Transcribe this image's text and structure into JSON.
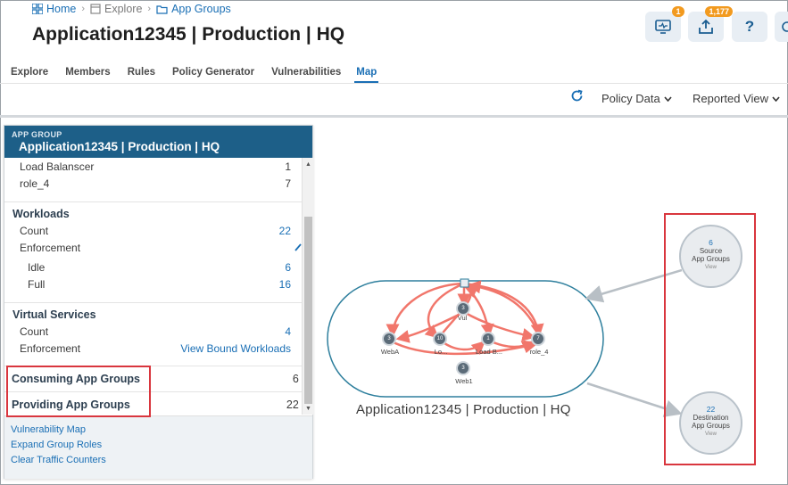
{
  "breadcrumb": {
    "home": "Home",
    "explore": "Explore",
    "app_groups": "App Groups"
  },
  "page_title": "Application12345 | Production | HQ",
  "header_buttons": {
    "notifications_badge": "1",
    "upload_badge": "1,177",
    "help": "?"
  },
  "tabs": [
    "Explore",
    "Members",
    "Rules",
    "Policy Generator",
    "Vulnerabilities",
    "Map"
  ],
  "active_tab": "Map",
  "toolbar": {
    "policy_data": "Policy Data",
    "reported_view": "Reported View"
  },
  "panel": {
    "header_label": "APP GROUP",
    "header_title": "Application12345 | Production | HQ",
    "roles": [
      {
        "label": "Load Balanscer",
        "value": "1"
      },
      {
        "label": "role_4",
        "value": "7"
      }
    ],
    "workloads": {
      "title": "Workloads",
      "count_label": "Count",
      "count": "22",
      "enforcement_label": "Enforcement",
      "idle_label": "Idle",
      "idle": "6",
      "full_label": "Full",
      "full": "16"
    },
    "virtual_services": {
      "title": "Virtual Services",
      "count_label": "Count",
      "count": "4",
      "enforcement_label": "Enforcement",
      "enforcement_link": "View Bound Workloads"
    },
    "consuming": {
      "label": "Consuming App Groups",
      "value": "6"
    },
    "providing": {
      "label": "Providing App Groups",
      "value": "22"
    },
    "links": [
      "Vulnerability Map",
      "Expand Group Roles",
      "Clear Traffic Counters"
    ]
  },
  "map": {
    "group_caption": "Application12345 | Production | HQ",
    "nodes": [
      {
        "label": "WebA",
        "count": "3"
      },
      {
        "label": "Lo...",
        "count": "10"
      },
      {
        "label": "Load B...",
        "count": "1"
      },
      {
        "label": "role_4",
        "count": "7"
      },
      {
        "label": "Web1",
        "count": "3"
      },
      {
        "label": "Vul",
        "count": "3"
      }
    ],
    "source": {
      "count": "6",
      "label1": "Source",
      "label2": "App Groups",
      "view": "View"
    },
    "destination": {
      "count": "22",
      "label1": "Destination",
      "label2": "App Groups",
      "view": "View"
    }
  },
  "colors": {
    "accent": "#1a6fb5",
    "panel_header": "#1d5f88",
    "flow": "#f0685c",
    "highlight": "#d9363e",
    "badge": "#f29a1f"
  }
}
